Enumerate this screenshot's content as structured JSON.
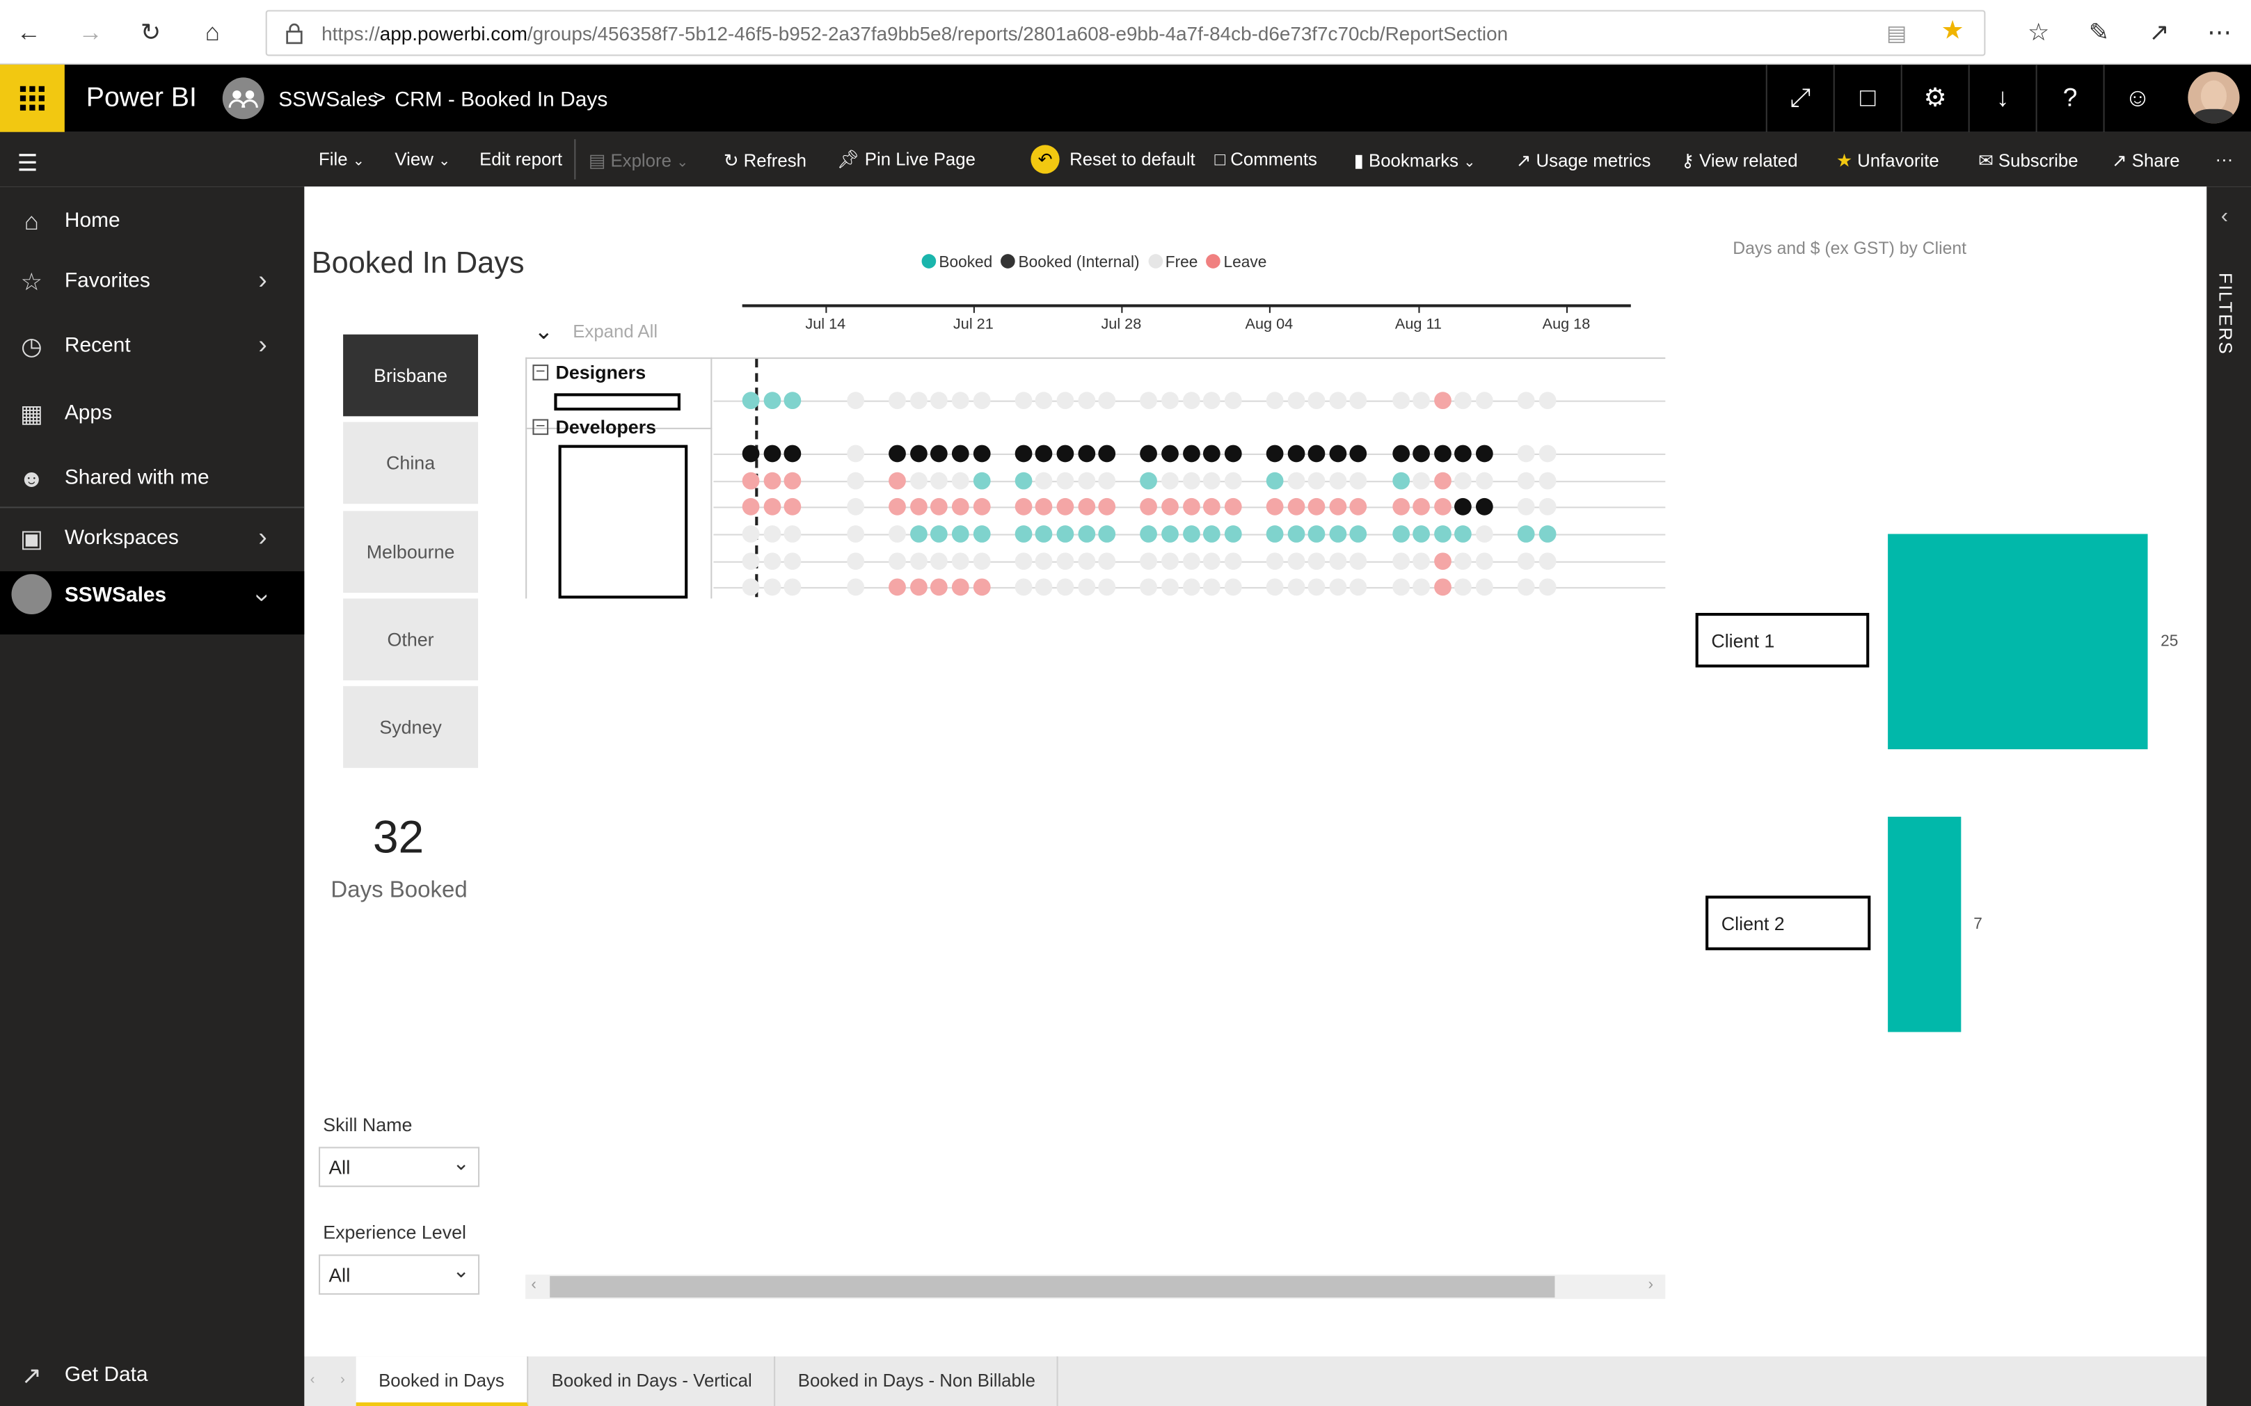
{
  "browser": {
    "url_prefix": "https://",
    "url_host": "app.powerbi.com",
    "url_path": "/groups/456358f7-5b12-46f5-b952-2a37fa9bb5e8/reports/2801a608-e9bb-4a7f-84cb-d6e73f7c70cb/ReportSection"
  },
  "header": {
    "app_name": "Power BI",
    "workspace": "SSWSales",
    "separator": ">",
    "report": "CRM - Booked In Days"
  },
  "toolbar": {
    "file": "File",
    "view": "View",
    "edit": "Edit report",
    "explore": "Explore",
    "refresh": "Refresh",
    "pin": "Pin Live Page",
    "reset": "Reset to default",
    "comments": "Comments",
    "bookmarks": "Bookmarks",
    "usage": "Usage metrics",
    "related": "View related",
    "unfavorite": "Unfavorite",
    "subscribe": "Subscribe",
    "share": "Share",
    "more": "···"
  },
  "sidebar": {
    "items": [
      {
        "label": "Home"
      },
      {
        "label": "Favorites"
      },
      {
        "label": "Recent"
      },
      {
        "label": "Apps"
      },
      {
        "label": "Shared with me"
      },
      {
        "label": "Workspaces"
      },
      {
        "label": "SSWSales"
      }
    ],
    "get_data": "Get Data"
  },
  "filters_label": "FILTERS",
  "report": {
    "title": "Booked In Days",
    "legend": [
      {
        "label": "Booked",
        "color": "#1ab5ac"
      },
      {
        "label": "Booked (Internal)",
        "color": "#333333"
      },
      {
        "label": "Free",
        "color": "#e6e6e6"
      },
      {
        "label": "Leave",
        "color": "#f08080"
      }
    ],
    "slicer": [
      "Brisbane",
      "China",
      "Melbourne",
      "Other",
      "Sydney"
    ],
    "slicer_selected": "Brisbane",
    "kpi_value": "32",
    "kpi_label": "Days Booked",
    "skill_label": "Skill Name",
    "skill_value": "All",
    "exp_label": "Experience Level",
    "exp_value": "All",
    "expand_all": "Expand All",
    "dates": [
      "Jul 14",
      "Jul 21",
      "Jul 28",
      "Aug 04",
      "Aug 11",
      "Aug 18"
    ],
    "groups": [
      "Designers",
      "Developers"
    ],
    "grid_rows": [
      "BBB..F.FFFFF.FFFFF.FFFFF.FFFFF.FFLFF.FF",
      "KKK..F.KKKKK.KKKKK.KKKKK.KKKKK.KKKKK.FF",
      "LLL..F.LFFFB.BFFFF.BFFFF.BFFFF.BFLFF.FF",
      "LLL..F.LLLLL.LLLLL.LLLLL.LLLLL.LLLKK.FF",
      "FFF..F.FBBBB.BBBBB.BBBBB.BBBBB.BBBBF.BB",
      "FFF..F.FFFFF.FFFFF.FFFFF.FFFFF.FFLFF.FF",
      "FFF..F.LLLLL.FFFFF.FFFFF.FFFFF.FFLFF.FF"
    ]
  },
  "client_chart_title": "Days and $ (ex GST) by Client",
  "chart_data": {
    "type": "bar",
    "title": "Days and $ (ex GST) by Client",
    "categories": [
      "Client 1",
      "Client 2"
    ],
    "values": [
      25,
      7
    ],
    "color": "#01b8aa"
  },
  "tabs": [
    "Booked in Days",
    "Booked in Days - Vertical",
    "Booked in Days - Non Billable"
  ]
}
